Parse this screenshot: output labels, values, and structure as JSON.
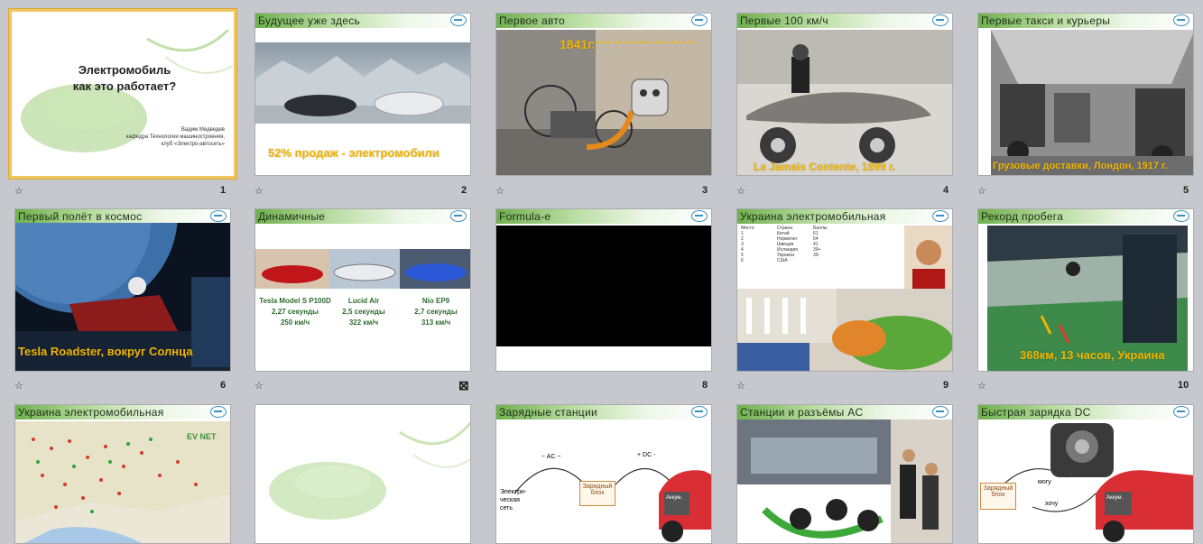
{
  "slides": [
    {
      "num": "1",
      "title": "",
      "main_title": "Электромобиль\nкак это работает?",
      "author": "Вадим Медведев",
      "dept": "кафедра Технологии машиностроения,",
      "club": "клуб «Электро-автосеть»"
    },
    {
      "num": "2",
      "title": "Будущее уже здесь",
      "overlay": "52% продаж - электромобили"
    },
    {
      "num": "3",
      "title": "Первое авто",
      "overlay": "1841г."
    },
    {
      "num": "4",
      "title": "Первые 100 км/ч",
      "overlay": "La Jamais Contente, 1899 г."
    },
    {
      "num": "5",
      "title": "Первые такси и курьеры",
      "overlay": "Грузовые доставки, Лондон, 1917 г."
    },
    {
      "num": "6",
      "title": "Первый полёт в космос",
      "overlay": "Tesla Roadster, вокруг Солнца"
    },
    {
      "num": "",
      "title": "Динамичные",
      "cars": [
        {
          "name": "Tesla Model S P100D",
          "time": "2,27 секунды",
          "speed": "250 км/ч"
        },
        {
          "name": "Lucid Air",
          "time": "2,5 секунды",
          "speed": "322 км/ч"
        },
        {
          "name": "Nio EP9",
          "time": "2,7 секунды",
          "speed": "313 км/ч"
        }
      ]
    },
    {
      "num": "8",
      "title": "Formula-e"
    },
    {
      "num": "9",
      "title": "Украина электромобильная",
      "table_header": [
        "Место",
        "Страна",
        "Баллы"
      ],
      "table_rows": [
        [
          "1",
          "Китай",
          "61"
        ],
        [
          "2",
          "Норвегия",
          "54"
        ],
        [
          "3",
          "Швеция",
          "41"
        ],
        [
          "4",
          "Исландия",
          "39+"
        ],
        [
          "5",
          "Украина",
          "39-"
        ],
        [
          "6",
          "США",
          ""
        ]
      ]
    },
    {
      "num": "10",
      "title": "Рекорд пробега",
      "overlay": "368км, 13 часов, Украина"
    },
    {
      "num": "",
      "title": "Украина электромобильная"
    },
    {
      "num": "",
      "title": ""
    },
    {
      "num": "",
      "title": "Зарядные станции",
      "ac": "~ AC ~",
      "dc": "+ DC -",
      "grid": "Электри-\nческая\nсеть",
      "unit": "Зарядный\nблок",
      "battery": "Аккум."
    },
    {
      "num": "",
      "title": "Станции и разъёмы AC"
    },
    {
      "num": "",
      "title": "Быстрая зарядка DC",
      "unit": "Зарядный\nблок",
      "can": "могу",
      "want": "хочу",
      "battery": "Аккум."
    }
  ],
  "icons": {
    "star": "☆",
    "hidden": "⊠"
  }
}
